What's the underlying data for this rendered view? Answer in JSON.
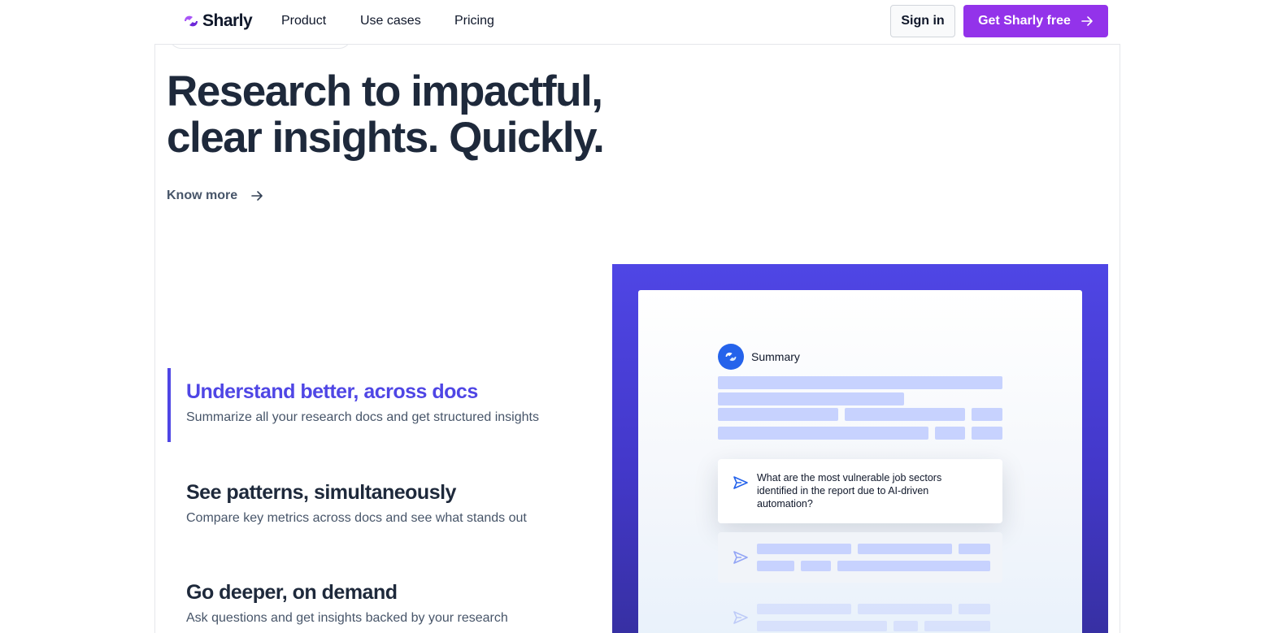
{
  "brand": {
    "name": "Sharly"
  },
  "nav": {
    "links": [
      "Product",
      "Use cases",
      "Pricing"
    ],
    "sign_in": "Sign in",
    "cta": "Get Sharly free"
  },
  "hero": {
    "title_line1": "Research to impactful,",
    "title_line2": "clear insights. Quickly.",
    "know_more": "Know more"
  },
  "features": [
    {
      "title": "Understand better, across docs",
      "desc": "Summarize all your research docs and get structured insights",
      "active": true
    },
    {
      "title": "See patterns, simultaneously",
      "desc": "Compare key metrics across docs and see what stands out",
      "active": false
    },
    {
      "title": "Go deeper, on demand",
      "desc": "Ask questions and get insights backed by your research",
      "active": false
    }
  ],
  "illustration": {
    "summary_label": "Summary",
    "question": "What are the most vulnerable job sectors identified in the report due to AI-driven automation?"
  },
  "colors": {
    "accent": "#4f46e5",
    "cta": "#9333ea",
    "skeleton": "#c7d2fe",
    "summary_icon": "#2563eb"
  }
}
